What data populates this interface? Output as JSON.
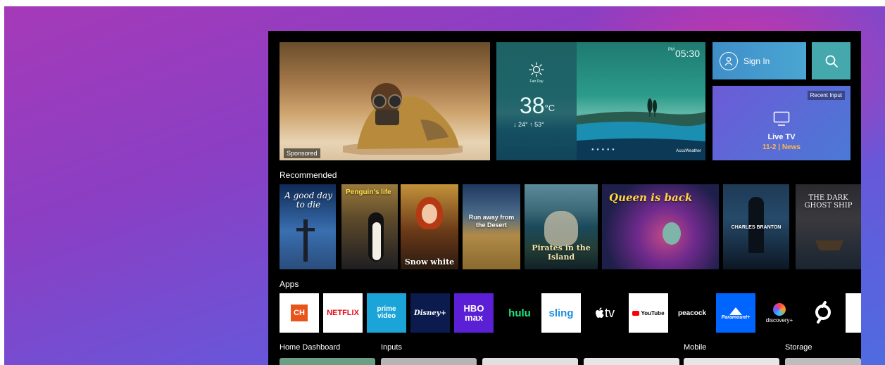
{
  "hero": {
    "badge": "Sponsored"
  },
  "weather": {
    "condition": "Fair Day",
    "temperature": "38",
    "unit": "°C",
    "low_high": "↓ 24°  ↑ 53°",
    "clock_ampm": "PM",
    "clock_time": "05:30",
    "provider": "AccuWeather",
    "page_dots": "● ● ● ● ●"
  },
  "signin": {
    "label": "Sign In"
  },
  "search": {
    "icon": "search-icon"
  },
  "live_tv": {
    "badge": "Recent Input",
    "label": "Live TV",
    "channel": "11-2 | News"
  },
  "recommended": {
    "title": "Recommended",
    "items": [
      {
        "title": "A good day to die"
      },
      {
        "title": "Penguin's life"
      },
      {
        "title": "Snow white"
      },
      {
        "title": "Run away from the Desert"
      },
      {
        "title": "Pirates in the Island"
      },
      {
        "title": "Queen is back"
      },
      {
        "title": "CHARLES BRANTON"
      },
      {
        "title": "THE DARK GHOST SHIP"
      }
    ]
  },
  "apps": {
    "title": "Apps",
    "items": [
      {
        "label": "CH",
        "icon": "lg-channels-icon"
      },
      {
        "label": "NETFLIX"
      },
      {
        "label": "prime video"
      },
      {
        "label": "Disney+"
      },
      {
        "label": "HBO max"
      },
      {
        "label": "hulu"
      },
      {
        "label": "sling"
      },
      {
        "label": "tv",
        "icon": "apple-logo-icon"
      },
      {
        "label": "YouTube"
      },
      {
        "label": "peacock"
      },
      {
        "label": "Paramount+"
      },
      {
        "label": "discovery+"
      },
      {
        "label": "peloton",
        "icon": "peloton-icon"
      },
      {
        "label": "",
        "icon": "app-icon"
      }
    ]
  },
  "bottom": {
    "home_dashboard": "Home Dashboard",
    "inputs": "Inputs",
    "mobile": "Mobile",
    "storage": "Storage"
  },
  "colors": {
    "background_gradient_start": "#a53ab8",
    "background_gradient_end": "#4f6be0",
    "live_tv_channel": "#ffb84d",
    "signin_tile": "#3f8ec9",
    "search_tile": "#44a8ad"
  }
}
